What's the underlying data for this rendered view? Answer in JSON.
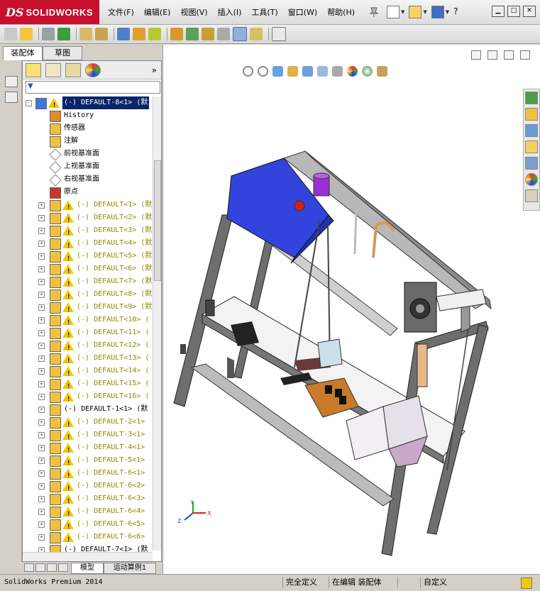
{
  "app": {
    "brand_prefix": "DS",
    "brand_name": "SOLIDWORKS"
  },
  "menu": [
    {
      "label": "文件(F)"
    },
    {
      "label": "编辑(E)"
    },
    {
      "label": "视图(V)"
    },
    {
      "label": "插入(I)"
    },
    {
      "label": "工具(T)"
    },
    {
      "label": "窗口(W)"
    },
    {
      "label": "帮助(H)"
    }
  ],
  "left_tabs": [
    {
      "label": "装配体",
      "active": true
    },
    {
      "label": "草图",
      "active": false
    }
  ],
  "tree": [
    {
      "label": "(-) DEFAULT-8<1> (默",
      "icon": "assembly-root-icon",
      "warn": true,
      "expand": "-",
      "level": 0,
      "style": "sel"
    },
    {
      "label": "History",
      "icon": "history-icon",
      "warn": false,
      "expand": "",
      "level": 1,
      "style": ""
    },
    {
      "label": "传感器",
      "icon": "sensor-icon",
      "warn": false,
      "expand": "",
      "level": 1,
      "style": ""
    },
    {
      "label": "注解",
      "icon": "annotation-icon",
      "warn": false,
      "expand": "",
      "level": 1,
      "style": ""
    },
    {
      "label": "前视基准面",
      "icon": "plane-icon",
      "warn": false,
      "expand": "",
      "level": 1,
      "style": ""
    },
    {
      "label": "上视基准面",
      "icon": "plane-icon",
      "warn": false,
      "expand": "",
      "level": 1,
      "style": ""
    },
    {
      "label": "右视基准面",
      "icon": "plane-icon",
      "warn": false,
      "expand": "",
      "level": 1,
      "style": ""
    },
    {
      "label": "原点",
      "icon": "origin-icon",
      "warn": false,
      "expand": "",
      "level": 1,
      "style": ""
    },
    {
      "label": "(-) DEFAULT<1> (默",
      "icon": "subassembly-icon",
      "warn": true,
      "expand": "+",
      "level": 1,
      "style": "yellow"
    },
    {
      "label": "(-) DEFAULT<2> (默",
      "icon": "subassembly-icon",
      "warn": true,
      "expand": "+",
      "level": 1,
      "style": "yellow"
    },
    {
      "label": "(-) DEFAULT<3> (默",
      "icon": "subassembly-icon",
      "warn": true,
      "expand": "+",
      "level": 1,
      "style": "yellow"
    },
    {
      "label": "(-) DEFAULT<4> (默",
      "icon": "subassembly-icon",
      "warn": true,
      "expand": "+",
      "level": 1,
      "style": "yellow"
    },
    {
      "label": "(-) DEFAULT<5> (默",
      "icon": "subassembly-icon",
      "warn": true,
      "expand": "+",
      "level": 1,
      "style": "yellow"
    },
    {
      "label": "(-) DEFAULT<6> (默",
      "icon": "subassembly-icon",
      "warn": true,
      "expand": "+",
      "level": 1,
      "style": "yellow"
    },
    {
      "label": "(-) DEFAULT<7> (默",
      "icon": "subassembly-icon",
      "warn": true,
      "expand": "+",
      "level": 1,
      "style": "yellow"
    },
    {
      "label": "(-) DEFAULT<8> (默",
      "icon": "subassembly-icon",
      "warn": true,
      "expand": "+",
      "level": 1,
      "style": "yellow"
    },
    {
      "label": "(-) DEFAULT<9> (默",
      "icon": "subassembly-icon",
      "warn": true,
      "expand": "+",
      "level": 1,
      "style": "yellow"
    },
    {
      "label": "(-) DEFAULT<10> (",
      "icon": "subassembly-icon",
      "warn": true,
      "expand": "+",
      "level": 1,
      "style": "yellow"
    },
    {
      "label": "(-) DEFAULT<11> (",
      "icon": "subassembly-icon",
      "warn": true,
      "expand": "+",
      "level": 1,
      "style": "yellow"
    },
    {
      "label": "(-) DEFAULT<12> (",
      "icon": "subassembly-icon",
      "warn": true,
      "expand": "+",
      "level": 1,
      "style": "yellow"
    },
    {
      "label": "(-) DEFAULT<13> (",
      "icon": "subassembly-icon",
      "warn": true,
      "expand": "+",
      "level": 1,
      "style": "yellow"
    },
    {
      "label": "(-) DEFAULT<14> (",
      "icon": "subassembly-icon",
      "warn": true,
      "expand": "+",
      "level": 1,
      "style": "yellow"
    },
    {
      "label": "(-) DEFAULT<15> (",
      "icon": "subassembly-icon",
      "warn": true,
      "expand": "+",
      "level": 1,
      "style": "yellow"
    },
    {
      "label": "(-) DEFAULT<16> (",
      "icon": "subassembly-icon",
      "warn": true,
      "expand": "+",
      "level": 1,
      "style": "yellow"
    },
    {
      "label": "(-) DEFAULT-1<1> (默",
      "icon": "subassembly-icon",
      "warn": false,
      "expand": "+",
      "level": 1,
      "style": ""
    },
    {
      "label": "(-) DEFAULT-2<1>",
      "icon": "subassembly-icon",
      "warn": true,
      "expand": "+",
      "level": 1,
      "style": "yellow"
    },
    {
      "label": "(-) DEFAULT-3<1>",
      "icon": "subassembly-icon",
      "warn": true,
      "expand": "+",
      "level": 1,
      "style": "yellow"
    },
    {
      "label": "(-) DEFAULT-4<1>",
      "icon": "subassembly-icon",
      "warn": true,
      "expand": "+",
      "level": 1,
      "style": "yellow"
    },
    {
      "label": "(-) DEFAULT-5<1>",
      "icon": "subassembly-icon",
      "warn": true,
      "expand": "+",
      "level": 1,
      "style": "yellow"
    },
    {
      "label": "(-) DEFAULT-6<1>",
      "icon": "subassembly-icon",
      "warn": true,
      "expand": "+",
      "level": 1,
      "style": "yellow"
    },
    {
      "label": "(-) DEFAULT-6<2>",
      "icon": "subassembly-icon",
      "warn": true,
      "expand": "+",
      "level": 1,
      "style": "yellow"
    },
    {
      "label": "(-) DEFAULT-6<3>",
      "icon": "subassembly-icon",
      "warn": true,
      "expand": "+",
      "level": 1,
      "style": "yellow"
    },
    {
      "label": "(-) DEFAULT-6<4>",
      "icon": "subassembly-icon",
      "warn": true,
      "expand": "+",
      "level": 1,
      "style": "yellow"
    },
    {
      "label": "(-) DEFAULT-6<5>",
      "icon": "subassembly-icon",
      "warn": true,
      "expand": "+",
      "level": 1,
      "style": "yellow"
    },
    {
      "label": "(-) DEFAULT-6<6>",
      "icon": "subassembly-icon",
      "warn": true,
      "expand": "+",
      "level": 1,
      "style": "yellow"
    },
    {
      "label": "(-) DEFAULT-7<1> (默",
      "icon": "subassembly-icon",
      "warn": false,
      "expand": "+",
      "level": 1,
      "style": ""
    }
  ],
  "bottom_tabs": [
    {
      "label": "模型"
    },
    {
      "label": "运动算例1"
    }
  ],
  "status": {
    "product": "SolidWorks Premium 2014",
    "state1": "完全定义",
    "state2": "在编辑 装配体",
    "state3": "自定义"
  },
  "triad": {
    "x": "X",
    "y": "Y",
    "z": "Z"
  },
  "colors": {
    "brand": "#c8102e",
    "selection": "#0a246a",
    "warning": "#f2c800",
    "grayed_label": "#8b8b00",
    "panel_blue": "#3344dd",
    "frame_gray": "#6e6e6e"
  }
}
